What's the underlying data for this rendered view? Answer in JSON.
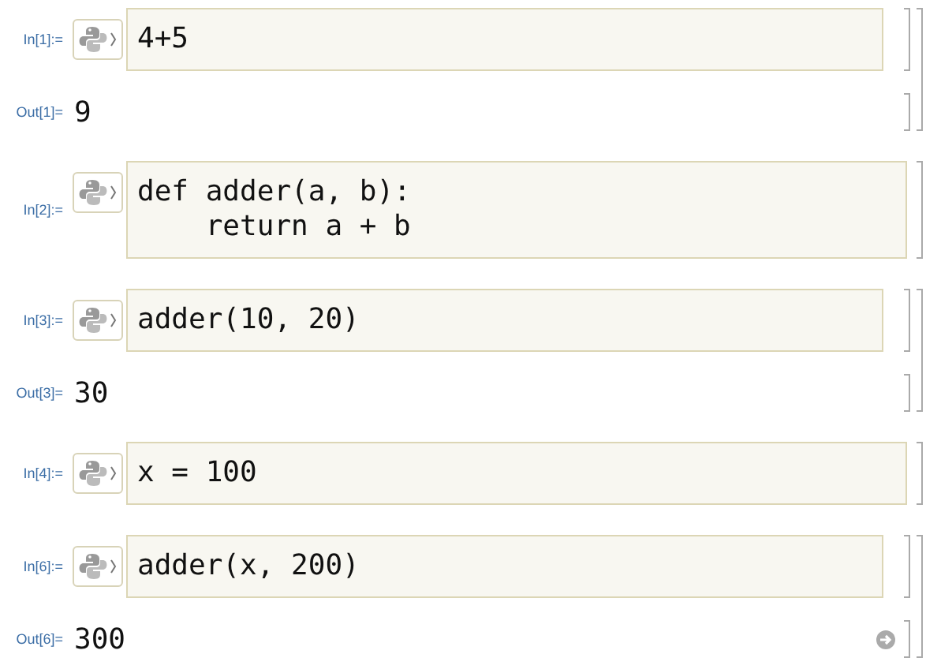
{
  "cells": [
    {
      "in_label": "In[1]:=",
      "code": [
        "4+5"
      ],
      "out_label": "Out[1]=",
      "output": "9"
    },
    {
      "in_label": "In[2]:=",
      "code": [
        "def adder(a, b):",
        "    return a + b"
      ]
    },
    {
      "in_label": "In[3]:=",
      "code": [
        "adder(10, 20)"
      ],
      "out_label": "Out[3]=",
      "output": "30"
    },
    {
      "in_label": "In[4]:=",
      "code": [
        "x = 100"
      ]
    },
    {
      "in_label": "In[6]:=",
      "code": [
        "adder(x, 200)"
      ],
      "out_label": "Out[6]=",
      "output": "300"
    }
  ]
}
